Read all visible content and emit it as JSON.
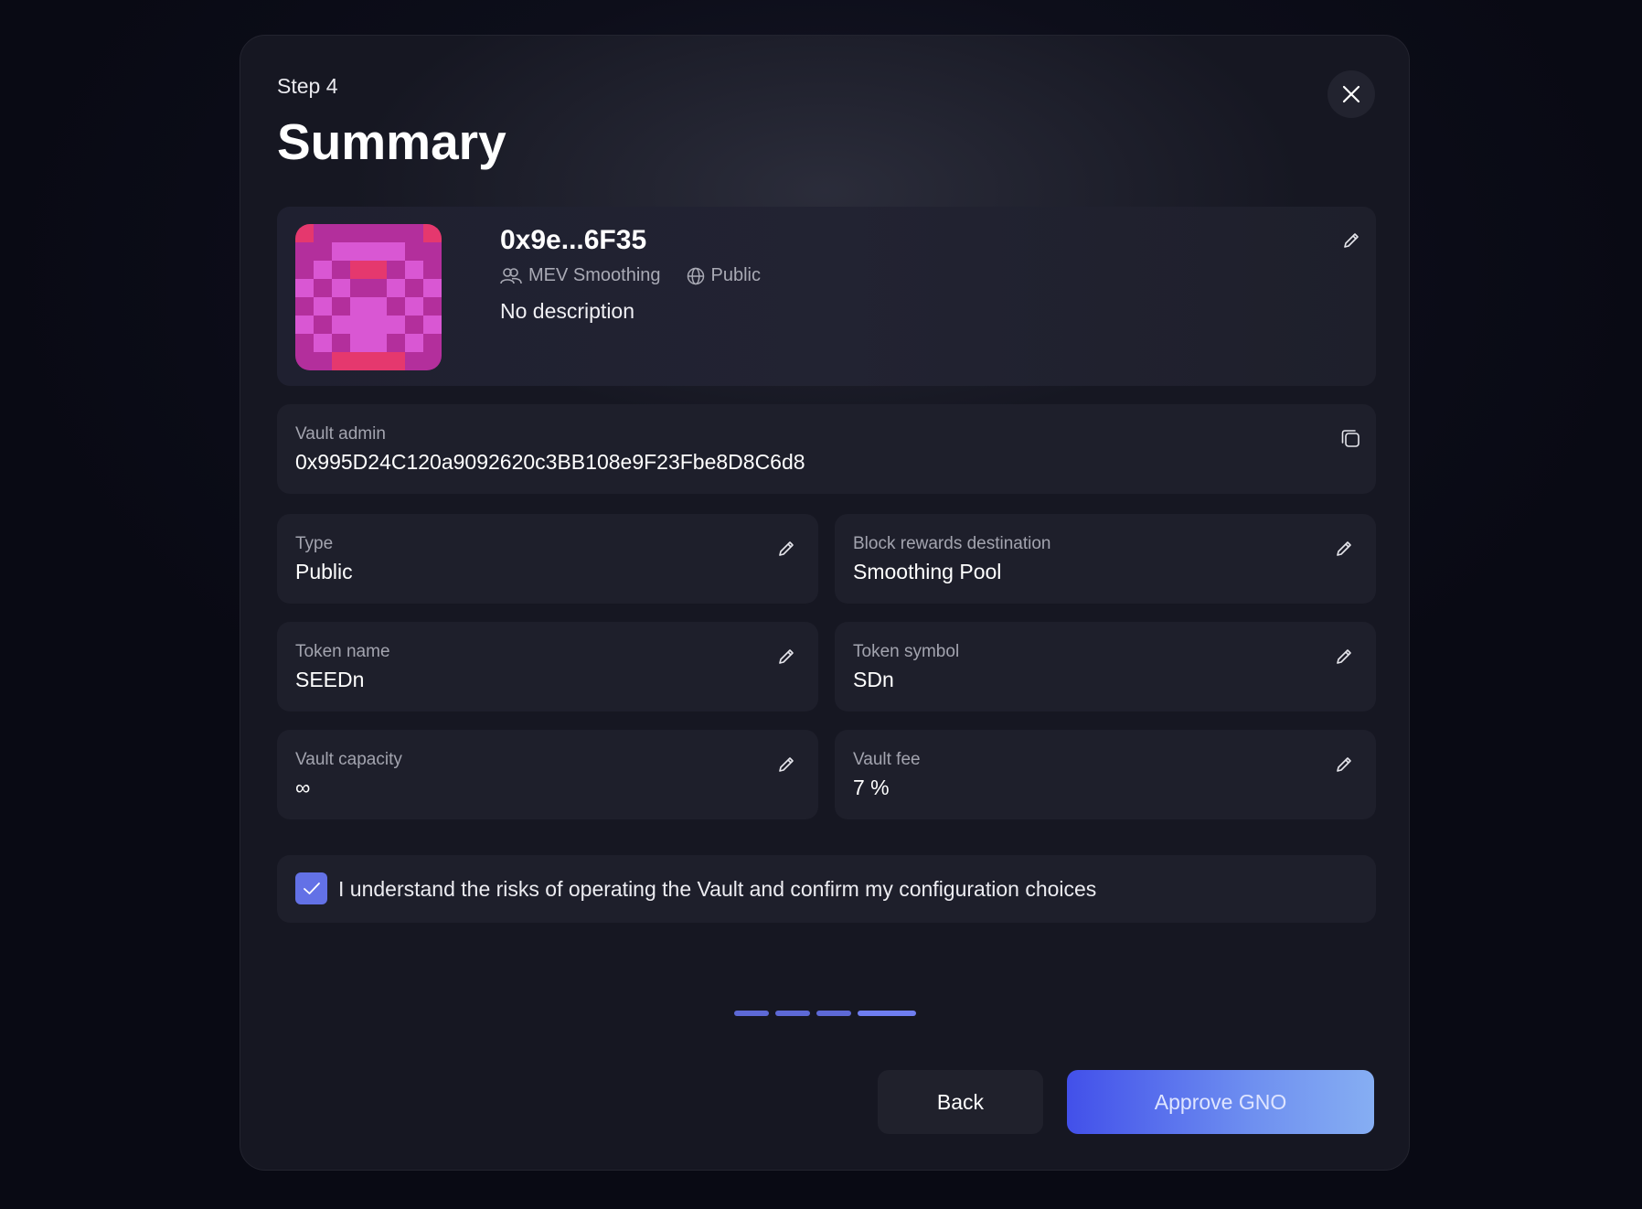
{
  "header": {
    "step": "Step 4",
    "title": "Summary"
  },
  "vault": {
    "address": "0x9e...6F35",
    "smoothing": "MEV Smoothing",
    "visibility": "Public",
    "description": "No description",
    "avatar_colors": {
      "light": "#d957d3",
      "dark": "#b32f9c",
      "accent": "#e5386e"
    }
  },
  "admin": {
    "label": "Vault admin",
    "value": "0x995D24C120a9092620c3BB108e9F23Fbe8D8C6d8"
  },
  "fields": {
    "type": {
      "label": "Type",
      "value": "Public"
    },
    "rewards": {
      "label": "Block rewards destination",
      "value": "Smoothing Pool"
    },
    "token_name": {
      "label": "Token name",
      "value": "SEEDn"
    },
    "token_symbol": {
      "label": "Token symbol",
      "value": "SDn"
    },
    "capacity": {
      "label": "Vault capacity",
      "value": "∞"
    },
    "fee": {
      "label": "Vault fee",
      "value": "7 %"
    }
  },
  "confirm": {
    "checked": true,
    "text": "I understand the risks of operating the Vault and confirm my configuration choices"
  },
  "progress": {
    "total_steps": 4,
    "current_step": 4
  },
  "actions": {
    "back": "Back",
    "approve": "Approve GNO"
  },
  "colors": {
    "accent": "#5d69d6",
    "approve_gradient_start": "#4250ea",
    "approve_gradient_end": "#86aef3"
  },
  "icons": {
    "close": "close-icon",
    "edit": "pencil-icon",
    "copy": "copy-icon",
    "users": "users-icon",
    "globe": "globe-icon",
    "check": "check-icon"
  }
}
